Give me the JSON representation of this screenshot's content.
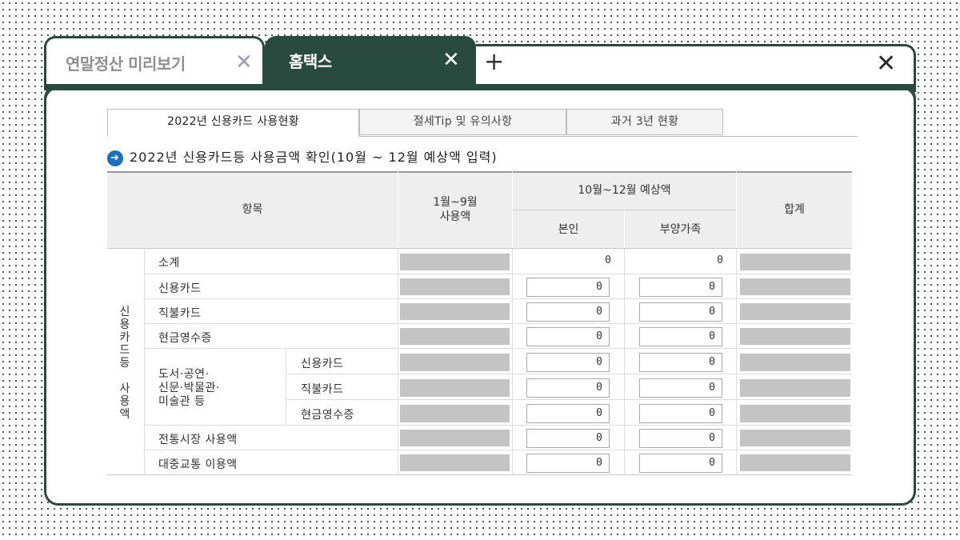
{
  "browser": {
    "tabs": [
      {
        "label": "연말정산 미리보기",
        "active": false
      },
      {
        "label": "홈택스",
        "active": true
      }
    ],
    "close_glyph": "✕",
    "new_tab_glyph": "+",
    "window_close_glyph": "✕"
  },
  "page": {
    "subtabs": [
      "2022년 신용카드 사용현황",
      "절세Tip 및 유의사항",
      "과거 3년 현황"
    ],
    "section_icon": "➜",
    "section_title": "2022년 신용카드등 사용금액 확인(10월 ~ 12월 예상액 입력)"
  },
  "table": {
    "headers": {
      "item": "항목",
      "jan_sep_line1": "1월~9월",
      "jan_sep_line2": "사용액",
      "oct_dec": "10월~12월 예상액",
      "self": "본인",
      "dependents": "부양가족",
      "total": "합계"
    },
    "group_label": "신용카드등 사용액",
    "culture_label_line1": "도서·공연·",
    "culture_label_line2": "신문·박물관·",
    "culture_label_line3": "미술관 등",
    "rows": [
      {
        "label": "소계",
        "self": "0",
        "dependents": "0",
        "editable": false
      },
      {
        "label": "신용카드",
        "self": "0",
        "dependents": "0",
        "editable": true
      },
      {
        "label": "직불카드",
        "self": "0",
        "dependents": "0",
        "editable": true
      },
      {
        "label": "현금영수증",
        "self": "0",
        "dependents": "0",
        "editable": true
      },
      {
        "label": "신용카드",
        "self": "0",
        "dependents": "0",
        "editable": true
      },
      {
        "label": "직불카드",
        "self": "0",
        "dependents": "0",
        "editable": true
      },
      {
        "label": "현금영수증",
        "self": "0",
        "dependents": "0",
        "editable": true
      },
      {
        "label": "전통시장 사용액",
        "self": "0",
        "dependents": "0",
        "editable": true
      },
      {
        "label": "대중교통 이용액",
        "self": "0",
        "dependents": "0",
        "editable": true
      }
    ]
  },
  "colors": {
    "frame": "#284a3f",
    "header_bg": "#eeeeee",
    "disabled_cell": "#c4c4c4",
    "bullet": "#1b6fbe"
  }
}
